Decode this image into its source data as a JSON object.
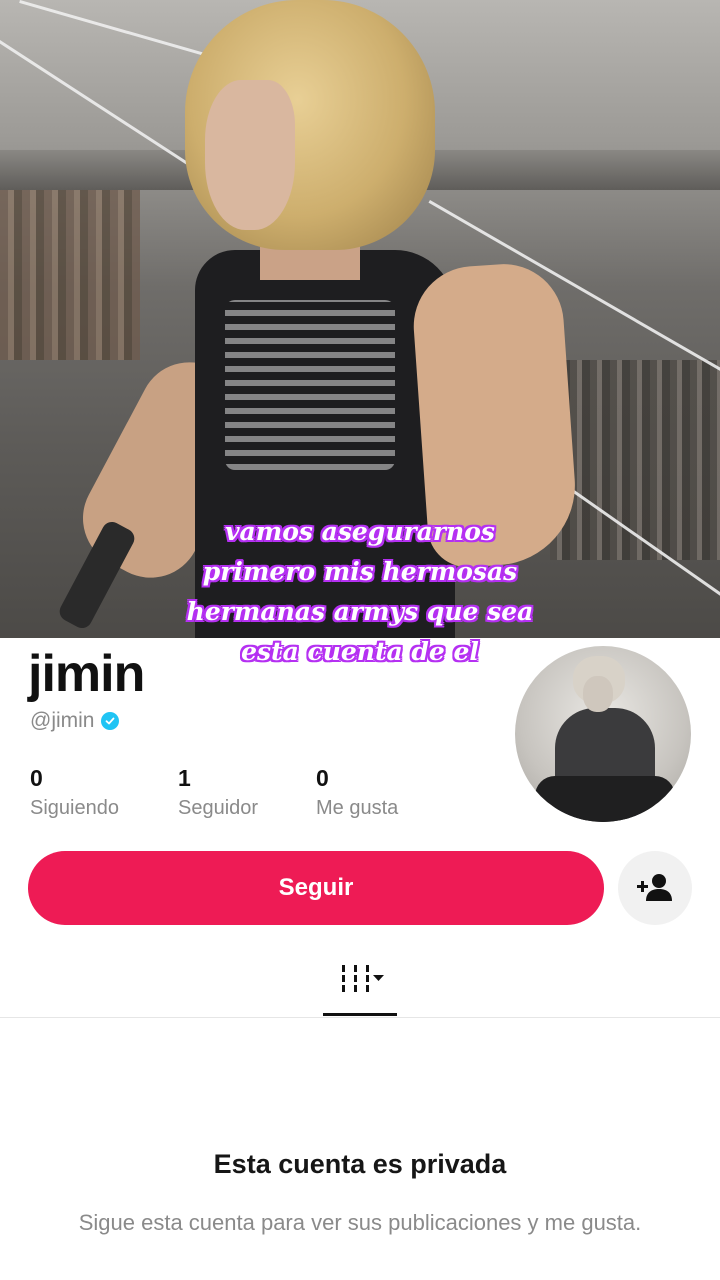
{
  "video": {
    "caption_lines": [
      "vamos asegurarnos",
      "primero mis hermosas",
      "hermanas armys que sea",
      "esta cuenta de el"
    ],
    "caption_color": "#b530f2"
  },
  "profile": {
    "username": "jimin",
    "handle": "@jimin",
    "verified": true,
    "verified_icon": "verified-badge-icon",
    "stats": [
      {
        "value": "0",
        "label": "Siguiendo"
      },
      {
        "value": "1",
        "label": "Seguidor"
      },
      {
        "value": "0",
        "label": "Me gusta"
      }
    ],
    "follow_label": "Seguir",
    "suggest_icon": "add-user-icon",
    "accent_color": "#ee1b55"
  },
  "tabs": {
    "active_icon": "grid-dropdown-icon"
  },
  "private_notice": {
    "title": "Esta cuenta es privada",
    "description": "Sigue esta cuenta para ver sus publicaciones y me gusta."
  }
}
